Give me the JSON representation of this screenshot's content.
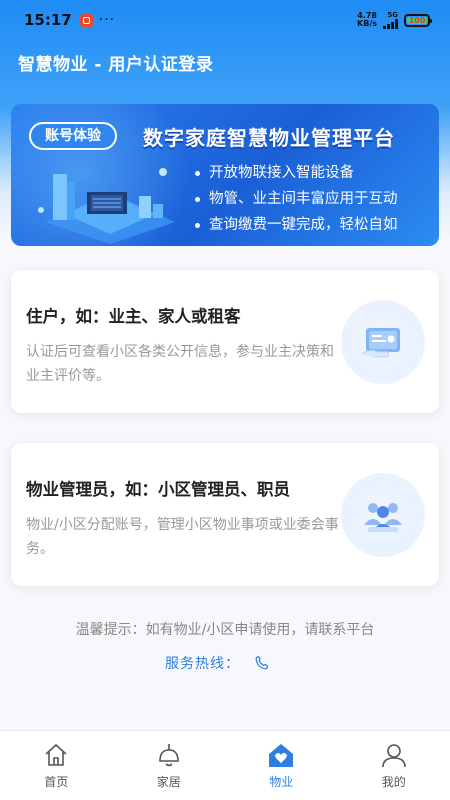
{
  "status_bar": {
    "time": "15:17",
    "dots": "···",
    "net_speed_value": "4.78",
    "net_speed_unit": "KB/s",
    "signal_label": "5G",
    "battery": "100"
  },
  "header": {
    "title": "智慧物业 - 用户认证登录"
  },
  "banner": {
    "tag": "账号体验",
    "title": "数字家庭智慧物业管理平台",
    "features": [
      "开放物联接入智能设备",
      "物管、业主间丰富应用于互动",
      "查询缴费一键完成，轻松自如"
    ]
  },
  "cards": [
    {
      "title": "住户，如：业主、家人或租客",
      "description": "认证后可查看小区各类公开信息，参与业主决策和业主评价等。",
      "icon": "id-card-icon"
    },
    {
      "title": "物业管理员，如：小区管理员、职员",
      "description": "物业/小区分配账号，管理小区物业事项或业委会事务。",
      "icon": "staff-group-icon"
    }
  ],
  "tip": "温馨提示：如有物业/小区申请使用，请联系平台",
  "hotline": {
    "label": "服务热线：",
    "icon": "phone-icon"
  },
  "tabbar": {
    "items": [
      {
        "label": "首页",
        "icon": "home-icon"
      },
      {
        "label": "家居",
        "icon": "ceiling-lamp-icon"
      },
      {
        "label": "物业",
        "icon": "property-heart-icon",
        "active": true
      },
      {
        "label": "我的",
        "icon": "user-icon"
      }
    ]
  },
  "colors": {
    "primary": "#2f7fe0",
    "header_gradient_top": "#1f8cf5",
    "muted_text": "#999999"
  }
}
